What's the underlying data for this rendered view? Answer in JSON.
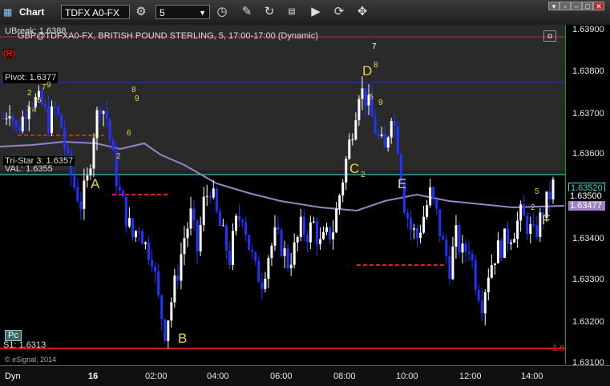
{
  "toolbar": {
    "title": "Chart",
    "symbol": "TDFX A0-FX",
    "interval": "5"
  },
  "chart": {
    "header_line": "GBP@TDFXA0-FX, BRITISH POUND STERLING, 5, 17:00-17:00 (Dynamic)",
    "ubreak": "UBreak: 1.6388",
    "r_badge": "(R)",
    "pivot": "Pivot: 1.6377",
    "tristar": "Tri-Star 3: 1.6357",
    "val": "VAL: 1.6355",
    "s1": "S1: 1.6313",
    "pc": "Pc",
    "s1_right": "1.6",
    "copyright": "© eSignal, 2014",
    "events": {
      "A": "A",
      "B": "B",
      "C": "C",
      "D": "D",
      "E": "E",
      "F": "F"
    }
  },
  "y_axis": {
    "ticks": [
      "1.63900",
      "1.63800",
      "1.63700",
      "1.63600",
      "1.63400",
      "1.63300",
      "1.63200",
      "1.63100"
    ],
    "marker_cyan": "1.63520",
    "marker_black": "1.63500",
    "marker_purple": "1.63477"
  },
  "x_axis": {
    "ticks": [
      "16",
      "02:00",
      "04:00",
      "06:00",
      "08:00",
      "10:00",
      "12:00",
      "14:00"
    ]
  },
  "bottom": {
    "dyn": "Dyn"
  },
  "colors": {
    "up": "#ffffff",
    "down": "#2233ff",
    "ma": "#9d80c8",
    "pivot": "#2a2ad8",
    "ubreak": "#c03030",
    "cyan": "#40d8d0",
    "s1": "#d01010",
    "red_dash": "#e02020",
    "label": "#e8d44d"
  },
  "chart_data": {
    "type": "candlestick",
    "x_ticks": [
      "16",
      "02:00",
      "04:00",
      "06:00",
      "08:00",
      "10:00",
      "12:00",
      "14:00"
    ],
    "ylim": [
      1.631,
      1.639
    ],
    "levels": {
      "ubreak": 1.6388,
      "pivot": 1.6377,
      "tristar3": 1.6357,
      "val": 1.6355,
      "s1": 1.6313,
      "last": 1.6352,
      "ma": 1.63477
    },
    "path_close": [
      1.6368,
      1.6371,
      1.6365,
      1.6368,
      1.6373,
      1.6372,
      1.6371,
      1.6367,
      1.637,
      1.6366,
      1.6357,
      1.6352,
      1.6348,
      1.6353,
      1.6365,
      1.6372,
      1.6368,
      1.6358,
      1.635,
      1.6345,
      1.634,
      1.6343,
      1.6338,
      1.6336,
      1.6325,
      1.6318,
      1.6325,
      1.6332,
      1.634,
      1.6345,
      1.6337,
      1.6348,
      1.6352,
      1.6345,
      1.634,
      1.6335,
      1.6343,
      1.6346,
      1.6338,
      1.6332,
      1.633,
      1.6336,
      1.634,
      1.6338,
      1.6334,
      1.6337,
      1.6342,
      1.6341,
      1.6343,
      1.6338,
      1.634,
      1.6342,
      1.635,
      1.6358,
      1.6366,
      1.6375,
      1.6373,
      1.6368,
      1.6363,
      1.636,
      1.637,
      1.6362,
      1.6348,
      1.6342,
      1.634,
      1.6345,
      1.635,
      1.6345,
      1.6338,
      1.6333,
      1.634,
      1.6336,
      1.6338,
      1.633,
      1.6325,
      1.6332,
      1.6336,
      1.6338,
      1.634,
      1.6342,
      1.6345,
      1.6343,
      1.634,
      1.6344,
      1.6348,
      1.6352
    ]
  }
}
